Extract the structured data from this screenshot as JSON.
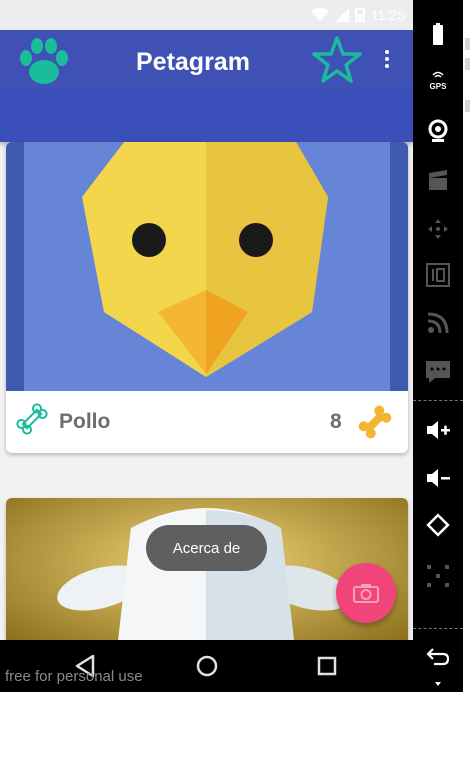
{
  "status_bar": {
    "time": "11:25"
  },
  "app_bar": {
    "title": "Petagram",
    "icons": [
      "paw-icon",
      "star-icon",
      "more-vert-icon"
    ]
  },
  "cards": [
    {
      "name": "Pollo",
      "rating": "8",
      "image": "chick-illustration"
    },
    {
      "image": "sheep-illustration"
    }
  ],
  "toast": {
    "text": "Acerca de"
  },
  "fab": {
    "icon": "camera-icon",
    "color": "#f0447b"
  },
  "nav_bar": {
    "icons": [
      "back-icon",
      "home-icon",
      "recents-icon"
    ]
  },
  "watermark": "free for personal use",
  "emulator_panel": {
    "items": [
      "battery-icon",
      "gps-icon",
      "camera-icon",
      "video-icon",
      "move-icon",
      "id-icon",
      "rss-icon",
      "chat-icon",
      "volume-up-icon",
      "volume-down-icon",
      "rotate-icon",
      "grid-icon",
      "back-icon",
      "expand-icon"
    ],
    "gps_label": "GPS"
  },
  "colors": {
    "primary": "#3f51b5",
    "accent": "#1abc9c",
    "chick_yellow": "#f2d44a",
    "chick_bg": "#6785d6"
  }
}
